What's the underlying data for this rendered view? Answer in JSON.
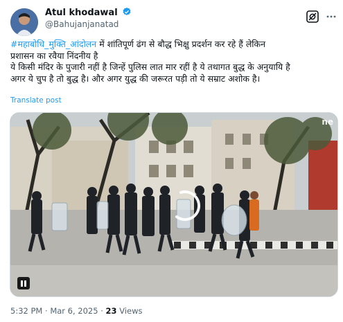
{
  "author": {
    "name": "Atul khodawal",
    "handle": "@Bahujanjanatad",
    "verified_color": "#1d9bf0"
  },
  "tweet": {
    "hashtag": "#महाबोधि_मुक्ति_आंदोलन",
    "line1_rest": " में शांतिपूर्ण ढंग से बौद्ध भिक्षु प्रदर्शन कर रहे हैं लेकिन",
    "line2": "प्रशासन का  रवैया निंदनीय है",
    "line3": "ये किसी मंदिर के पुजारी नहीं है जिन्हें पुलिस लात मार रहीं है ये तथागत बुद्ध के अनुयायि है",
    "line4": "अगर ये चुप है तो बुद्ध है। और अगर युद्ध की जरूरत पड़ी तो ये सम्राट अशोक है।",
    "translate_label": "Translate post"
  },
  "media": {
    "watermark": "ne",
    "playback_state": "paused",
    "icons": [
      "pause-icon",
      "loading-spinner-icon"
    ]
  },
  "meta": {
    "time": "5:32 PM",
    "separator": " · ",
    "date": "Mar 6, 2025",
    "views_count": "23",
    "views_label": " Views"
  },
  "icons": {
    "grok": "grok-icon",
    "more": "more-options-icon",
    "verified": "verified-badge-icon"
  }
}
